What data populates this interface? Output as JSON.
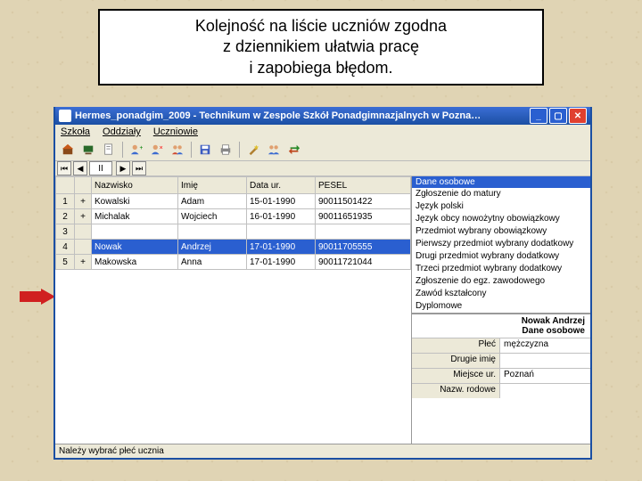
{
  "caption": {
    "l1": "Kolejność na liście uczniów zgodna",
    "l2": "z dziennikiem ułatwia pracę",
    "l3": "i zapobiega błędom."
  },
  "window": {
    "title": "Hermes_ponadgim_2009 - Technikum w Zespole Szkół Ponadgimnazjalnych w Pozna…"
  },
  "menu": [
    "Szkoła",
    "Oddziały",
    "Uczniowie"
  ],
  "nav": {
    "class_label": "II"
  },
  "grid": {
    "headers": [
      "Nazwisko",
      "Imię",
      "Data ur.",
      "PESEL"
    ],
    "rows": [
      {
        "n": "1",
        "m": "+",
        "nazwisko": "Kowalski",
        "imie": "Adam",
        "data": "15-01-1990",
        "pesel": "90011501422"
      },
      {
        "n": "2",
        "m": "+",
        "nazwisko": "Michalak",
        "imie": "Wojciech",
        "data": "16-01-1990",
        "pesel": "90011651935"
      },
      {
        "n": "3",
        "m": "",
        "nazwisko": "",
        "imie": "",
        "data": "",
        "pesel": ""
      },
      {
        "n": "4",
        "m": "",
        "nazwisko": "Nowak",
        "imie": "Andrzej",
        "data": "17-01-1990",
        "pesel": "90011705555",
        "selected": true
      },
      {
        "n": "5",
        "m": "+",
        "nazwisko": "Makowska",
        "imie": "Anna",
        "data": "17-01-1990",
        "pesel": "90011721044"
      }
    ]
  },
  "categories": {
    "header": "Dane osobowe",
    "items": [
      "Zgłoszenie do matury",
      "Język polski",
      "Język obcy nowożytny obowiązkowy",
      "Przedmiot wybrany obowiązkowy",
      "Pierwszy przedmiot wybrany dodatkowy",
      "Drugi przedmiot wybrany dodatkowy",
      "Trzeci przedmiot wybrany dodatkowy",
      "Zgłoszenie do egz. zawodowego",
      "Zawód kształcony",
      "Dyplomowe"
    ]
  },
  "details": {
    "name_line1": "Nowak Andrzej",
    "name_line2": "Dane osobowe",
    "fields": [
      {
        "label": "Płeć",
        "value": "mężczyzna"
      },
      {
        "label": "Drugie imię",
        "value": ""
      },
      {
        "label": "Miejsce ur.",
        "value": "Poznań"
      },
      {
        "label": "Nazw. rodowe",
        "value": ""
      }
    ]
  },
  "status": "Należy wybrać płeć ucznia"
}
